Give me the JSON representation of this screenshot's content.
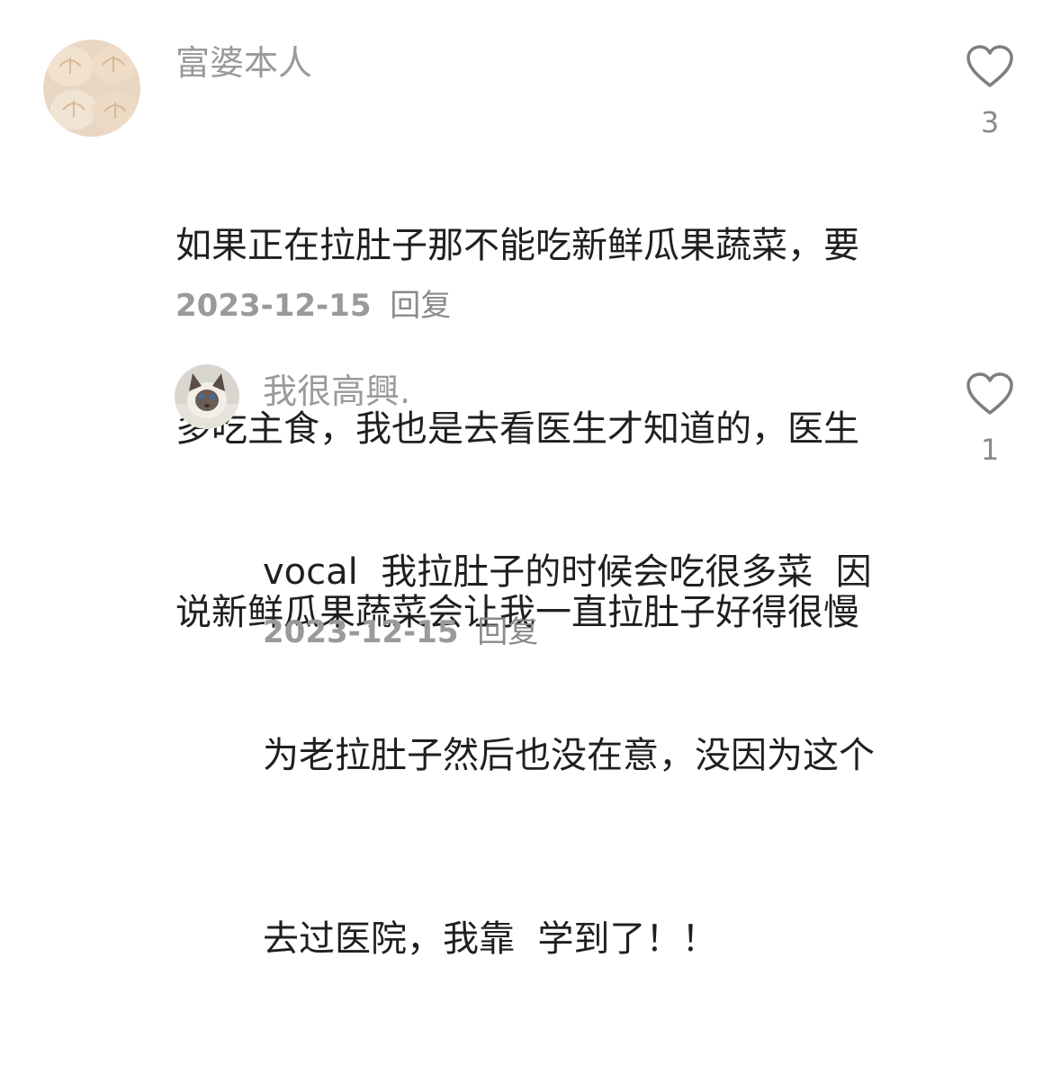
{
  "comments": [
    {
      "username": "富婆本人",
      "avatar_icon": "dumpling-avatar",
      "lines": [
        "如果正在拉肚子那不能吃新鲜瓜果蔬菜，要",
        "多吃主食，我也是去看医生才知道的，医生",
        "说新鲜瓜果蔬菜会让我一直拉肚子好得很慢"
      ],
      "date": "2023-12-15",
      "reply_label": "回复",
      "like_icon": "heart-outline-icon",
      "like_count": "3"
    },
    {
      "username": "我很高興.",
      "avatar_icon": "cat-avatar",
      "lines": [
        "vocal  我拉肚子的时候会吃很多菜  因",
        "为老拉肚子然后也没在意，没因为这个",
        "去过医院，我靠  学到了！！"
      ],
      "date": "2023-12-15",
      "reply_label": "回复",
      "like_icon": "heart-outline-icon",
      "like_count": "1"
    }
  ]
}
